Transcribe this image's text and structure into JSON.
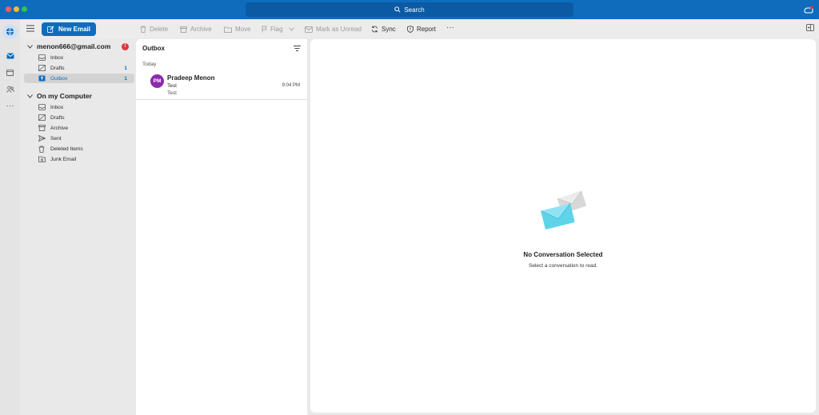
{
  "titlebar": {
    "search_label": "Search"
  },
  "toolbar": {
    "new_email_label": "New Email",
    "delete_label": "Delete",
    "archive_label": "Archive",
    "move_label": "Move",
    "flag_label": "Flag",
    "mark_unread_label": "Mark as Unread",
    "sync_label": "Sync",
    "report_label": "Report",
    "more_label": "···"
  },
  "rail": {
    "more_label": "···"
  },
  "folders": {
    "account": {
      "name": "menon666@gmail.com",
      "alert_badge": "!",
      "items": [
        {
          "label": "Inbox",
          "count": ""
        },
        {
          "label": "Drafts",
          "count": "1"
        },
        {
          "label": "Outbox",
          "count": "1"
        }
      ]
    },
    "local": {
      "name": "On my Computer",
      "items": [
        {
          "label": "Inbox"
        },
        {
          "label": "Drafts"
        },
        {
          "label": "Archive"
        },
        {
          "label": "Sent"
        },
        {
          "label": "Deleted Items"
        },
        {
          "label": "Junk Email"
        }
      ]
    }
  },
  "message_list": {
    "title": "Outbox",
    "group": "Today",
    "messages": [
      {
        "initials": "PM",
        "sender": "Pradeep Menon",
        "subject": "Test",
        "preview": "Test",
        "time": "9:04 PM"
      }
    ]
  },
  "reading_pane": {
    "empty_title": "No Conversation Selected",
    "empty_subtitle": "Select a conversation to read."
  },
  "colors": {
    "accent": "#0f6cbd",
    "avatar": "#8b2aad",
    "alert": "#e0353b"
  }
}
